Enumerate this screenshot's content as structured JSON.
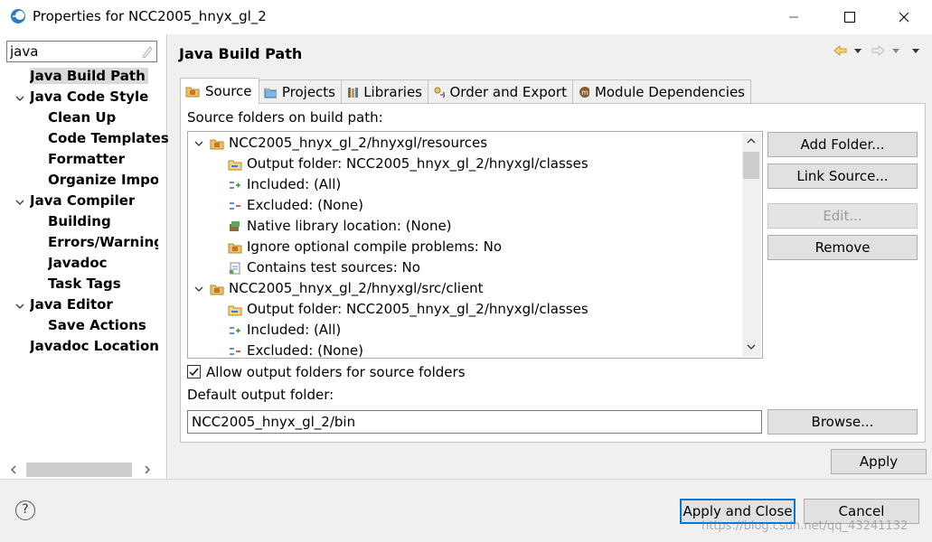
{
  "window": {
    "title": "Properties for NCC2005_hnyx_gl_2",
    "controls": [
      "minimize",
      "maximize",
      "close"
    ]
  },
  "filter": {
    "value": "java"
  },
  "sidebar": {
    "items": [
      {
        "label": "Java Build Path",
        "selected": true
      },
      {
        "label": "Java Code Style",
        "expanded": true
      },
      {
        "label": "Clean Up"
      },
      {
        "label": "Code Templates"
      },
      {
        "label": "Formatter"
      },
      {
        "label": "Organize Imports"
      },
      {
        "label": "Java Compiler",
        "expanded": true
      },
      {
        "label": "Building"
      },
      {
        "label": "Errors/Warnings"
      },
      {
        "label": "Javadoc"
      },
      {
        "label": "Task Tags"
      },
      {
        "label": "Java Editor",
        "expanded": true
      },
      {
        "label": "Save Actions"
      },
      {
        "label": "Javadoc Location"
      }
    ]
  },
  "page": {
    "title": "Java Build Path"
  },
  "tabs": [
    {
      "label": "Source",
      "icon": "source-folder-icon",
      "active": true
    },
    {
      "label": "Projects",
      "icon": "projects-icon"
    },
    {
      "label": "Libraries",
      "icon": "libraries-icon"
    },
    {
      "label": "Order and Export",
      "icon": "order-export-icon"
    },
    {
      "label": "Module Dependencies",
      "icon": "module-icon"
    }
  ],
  "source": {
    "label": "Source folders on build path:",
    "rows": [
      {
        "text": "NCC2005_hnyx_gl_2/hnyxgl/resources",
        "icon": "package-folder-icon"
      },
      {
        "text": "Output folder: NCC2005_hnyx_gl_2/hnyxgl/classes",
        "icon": "output-folder-icon"
      },
      {
        "text": "Included: (All)",
        "icon": "included-icon"
      },
      {
        "text": "Excluded: (None)",
        "icon": "excluded-icon"
      },
      {
        "text": "Native library location: (None)",
        "icon": "native-library-icon"
      },
      {
        "text": "Ignore optional compile problems: No",
        "icon": "ignore-problems-icon"
      },
      {
        "text": "Contains test sources: No",
        "icon": "test-sources-icon"
      },
      {
        "text": "NCC2005_hnyx_gl_2/hnyxgl/src/client",
        "icon": "package-folder-icon"
      },
      {
        "text": "Output folder: NCC2005_hnyx_gl_2/hnyxgl/classes",
        "icon": "output-folder-icon"
      },
      {
        "text": "Included: (All)",
        "icon": "included-icon"
      },
      {
        "text": "Excluded: (None)",
        "icon": "excluded-icon"
      }
    ]
  },
  "buttons": {
    "add_folder": "Add Folder...",
    "link_source": "Link Source...",
    "edit": "Edit...",
    "remove": "Remove",
    "browse": "Browse...",
    "apply": "Apply",
    "apply_close": "Apply and Close",
    "cancel": "Cancel"
  },
  "allow_output": {
    "label": "Allow output folders for source folders",
    "checked": true
  },
  "default_output": {
    "label": "Default output folder:",
    "value": "NCC2005_hnyx_gl_2/bin"
  },
  "help": "?",
  "watermark": "https://blog.csdn.net/qq_43241132",
  "colors": {
    "accent": "#0078d7",
    "selection": "#d9d9d9",
    "panel": "#f0f0f0"
  }
}
